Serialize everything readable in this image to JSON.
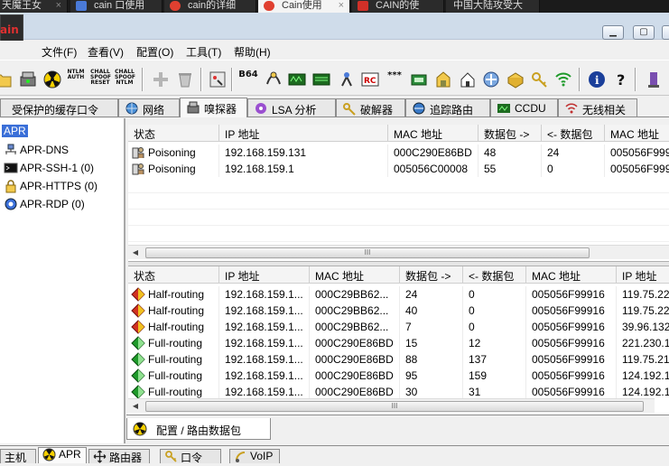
{
  "browser_tabs": [
    {
      "label": "天魔王女",
      "close": "×",
      "color": "#1b1b1b"
    },
    {
      "label": "cain 口使用",
      "close": "",
      "color": "#4a7ad8"
    },
    {
      "label": "cain的详细",
      "close": "",
      "color": "#e04030"
    },
    {
      "label": "Cain使用",
      "close": "×",
      "color": "#e04030"
    },
    {
      "label": "CAIN的使",
      "close": "",
      "color": "#d03028"
    },
    {
      "label": "中国大陆攻受大",
      "close": "",
      "color": ""
    }
  ],
  "app": {
    "logo": "ain",
    "window_buttons": {
      "minimize": "▁",
      "maximize": "▢",
      "close": "×"
    }
  },
  "menu": [
    "文件(F)",
    "查看(V)",
    "配置(O)",
    "工具(T)",
    "帮助(H)"
  ],
  "toolbar_text_buttons": {
    "ntlm_auth": [
      "NTLM",
      "AUTH"
    ],
    "chall_spoof_reset": [
      "CHALL",
      "SPOOF",
      "RESET"
    ],
    "chall_spoof_ntlm": [
      "CHALL",
      "SPOOF",
      "NTLM"
    ],
    "base64": "B64",
    "stars": "***"
  },
  "module_tabs": [
    {
      "label": "受保护的缓存口令",
      "icon": ""
    },
    {
      "label": "网络",
      "icon": "network-icon"
    },
    {
      "label": "嗅探器",
      "icon": "sniffer-icon"
    },
    {
      "label": "LSA 分析",
      "icon": "lsa-icon"
    },
    {
      "label": "破解器",
      "icon": "cracker-icon"
    },
    {
      "label": "追踪路由",
      "icon": "traceroute-icon"
    },
    {
      "label": "CCDU",
      "icon": "ccdu-icon"
    },
    {
      "label": "无线相关",
      "icon": "wireless-icon"
    }
  ],
  "tree": [
    {
      "label": "APR",
      "icon": "apr-icon"
    },
    {
      "label": "APR-DNS",
      "icon": "dns-icon"
    },
    {
      "label": "APR-SSH-1 (0)",
      "icon": "ssh-icon"
    },
    {
      "label": "APR-HTTPS (0)",
      "icon": "lock-icon"
    },
    {
      "label": "APR-RDP (0)",
      "icon": "rdp-icon"
    }
  ],
  "top_table": {
    "columns": [
      "状态",
      "IP 地址",
      "MAC 地址",
      "数据包 ->",
      "<- 数据包",
      "MAC 地址"
    ],
    "rows": [
      {
        "status": "Poisoning",
        "ip": "192.168.159.131",
        "mac": "000C290E86BD",
        "out": "48",
        "in": "24",
        "mac2": "005056F9991"
      },
      {
        "status": "Poisoning",
        "ip": "192.168.159.1",
        "mac": "005056C00008",
        "out": "55",
        "in": "0",
        "mac2": "005056F9991"
      }
    ],
    "scroll_grip": "III"
  },
  "bottom_table": {
    "columns": [
      "状态",
      "IP 地址",
      "MAC 地址",
      "数据包 ->",
      "<- 数据包",
      "MAC 地址",
      "IP 地址"
    ],
    "rows": [
      {
        "status": "Half-routing",
        "ip": "192.168.159.1...",
        "mac": "000C29BB62...",
        "out": "24",
        "in": "0",
        "mac2": "005056F99916",
        "ip2": "119.75.22"
      },
      {
        "status": "Half-routing",
        "ip": "192.168.159.1...",
        "mac": "000C29BB62...",
        "out": "40",
        "in": "0",
        "mac2": "005056F99916",
        "ip2": "119.75.22"
      },
      {
        "status": "Half-routing",
        "ip": "192.168.159.1...",
        "mac": "000C29BB62...",
        "out": "7",
        "in": "0",
        "mac2": "005056F99916",
        "ip2": "39.96.132"
      },
      {
        "status": "Full-routing",
        "ip": "192.168.159.1...",
        "mac": "000C290E86BD",
        "out": "15",
        "in": "12",
        "mac2": "005056F99916",
        "ip2": "221.230.1"
      },
      {
        "status": "Full-routing",
        "ip": "192.168.159.1...",
        "mac": "000C290E86BD",
        "out": "88",
        "in": "137",
        "mac2": "005056F99916",
        "ip2": "119.75.21"
      },
      {
        "status": "Full-routing",
        "ip": "192.168.159.1...",
        "mac": "000C290E86BD",
        "out": "95",
        "in": "159",
        "mac2": "005056F99916",
        "ip2": "124.192.1"
      },
      {
        "status": "Full-routing",
        "ip": "192.168.159.1...",
        "mac": "000C290E86BD",
        "out": "30",
        "in": "31",
        "mac2": "005056F99916",
        "ip2": "124.192.1"
      }
    ],
    "scroll_grip": "III"
  },
  "sub_tab": {
    "label": "配置 / 路由数据包",
    "icon": "radiation-icon"
  },
  "bottom_tabs": [
    {
      "label": "主机",
      "icon": ""
    },
    {
      "label": "APR",
      "icon": "radiation-icon"
    },
    {
      "label": "路由器",
      "icon": "router-icon"
    },
    {
      "label": "口令",
      "icon": "key-icon"
    },
    {
      "label": "VoIP",
      "icon": "voip-icon"
    }
  ],
  "colors": {
    "half_routing": "#d03020",
    "full_routing": "#1e9a2a",
    "tree_selection": "#3a6fd8",
    "title_bar": "#cfdcea"
  }
}
